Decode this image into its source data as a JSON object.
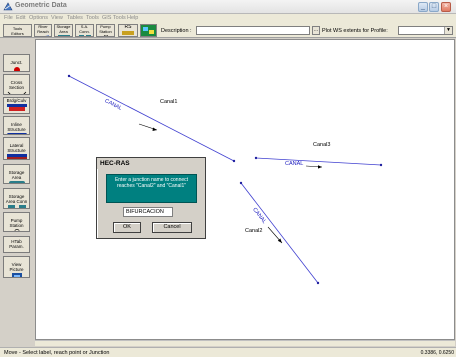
{
  "window": {
    "title": "Geometric Data",
    "minimize": "_",
    "maximize": "□",
    "close": "×"
  },
  "menu": [
    "File",
    "Edit",
    "Options",
    "View",
    "Tables",
    "Tools",
    "GIS Tools",
    "Help"
  ],
  "toolbar": {
    "tools_editors": "Tools\nEditors",
    "river_reach": "River\nReach",
    "storage_area": "Storage\nArea",
    "sa_conn": "S.A.\nConn.",
    "pump_station": "Pump\nStation",
    "rs": "RS",
    "description_label": "Description :",
    "description_value": "",
    "browse_label": "...",
    "plot_ws_label": "Plot WS extents for Profile:",
    "profile_value": ""
  },
  "side_editors": [
    {
      "label": "Junct."
    },
    {
      "label": "Cross\nSection"
    },
    {
      "label": "Brdg/Culv"
    },
    {
      "label": "Inline\nStructure"
    },
    {
      "label": "Lateral\nStructure"
    },
    {
      "label": "Storage\nArea"
    },
    {
      "label": "Storage\nArea Conn"
    },
    {
      "label": "Pump\nStation"
    },
    {
      "label": "HTab\nParam."
    },
    {
      "label": "View\nPicture"
    }
  ],
  "reaches": [
    {
      "river": "CANAL",
      "reach": "Canal1"
    },
    {
      "river": "CANAL",
      "reach": "Canal3"
    },
    {
      "river": "CANAL",
      "reach": "Canal2"
    }
  ],
  "dialog": {
    "title": "HEC-RAS",
    "message": "Enter a junction name to connect reaches \"Canal2\" and \"Canal1\"",
    "input_value": "BIFURCACION",
    "ok_label": "OK",
    "cancel_label": "Cancel"
  },
  "status": {
    "message": "Move - Select label, reach point or Junction",
    "coords": "0.3386, 0.6250"
  },
  "colors": {
    "reach_line": "#4040d0",
    "junction_dot": "#cc0000",
    "dialog_message_bg": "#008080"
  }
}
